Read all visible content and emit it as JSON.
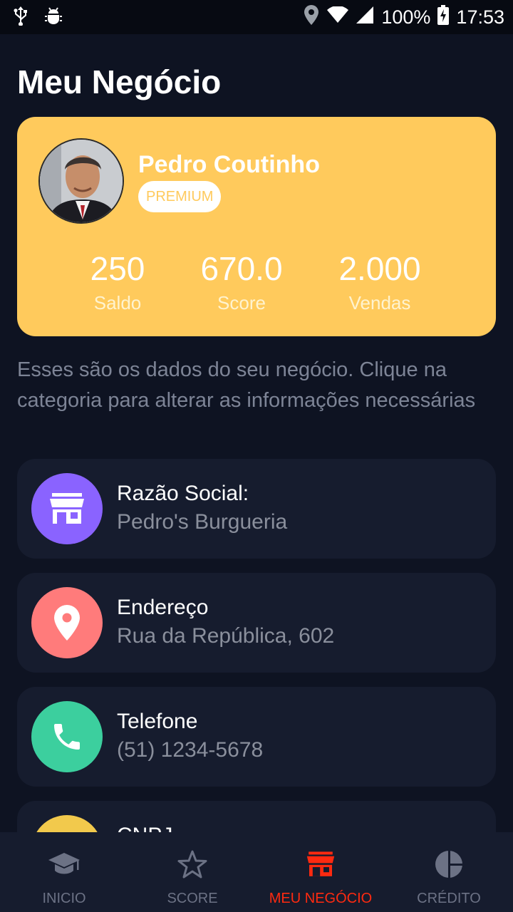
{
  "status_bar": {
    "battery": "100%",
    "time": "17:53"
  },
  "page": {
    "title": "Meu Negócio"
  },
  "profile": {
    "name": "Pedro Coutinho",
    "badge": "PREMIUM",
    "stats": [
      {
        "value": "250",
        "label": "Saldo"
      },
      {
        "value": "670.0",
        "label": "Score"
      },
      {
        "value": "2.000",
        "label": "Vendas"
      }
    ]
  },
  "description": "Esses são os dados do seu negócio. Clique na categoria para alterar as informações necessárias",
  "info_items": [
    {
      "label": "Razão Social:",
      "value": "Pedro's Burgueria",
      "icon": "store-icon",
      "color": "#8a63ff"
    },
    {
      "label": "Endereço",
      "value": "Rua da República, 602",
      "icon": "location-pin-icon",
      "color": "#ff7b7b"
    },
    {
      "label": "Telefone",
      "value": "(51) 1234-5678",
      "icon": "phone-icon",
      "color": "#3ccf9e"
    },
    {
      "label": "CNPJ",
      "value": "",
      "icon": "document-icon",
      "color": "#f2c94c"
    }
  ],
  "nav": {
    "items": [
      {
        "label": "INICIO",
        "icon": "graduation-cap-icon"
      },
      {
        "label": "SCORE",
        "icon": "star-icon"
      },
      {
        "label": "MEU NEGÓCIO",
        "icon": "store-icon"
      },
      {
        "label": "CRÉDITO",
        "icon": "pie-chart-icon"
      }
    ],
    "active_color": "#ff2a10",
    "inactive_color": "#6c7285"
  }
}
